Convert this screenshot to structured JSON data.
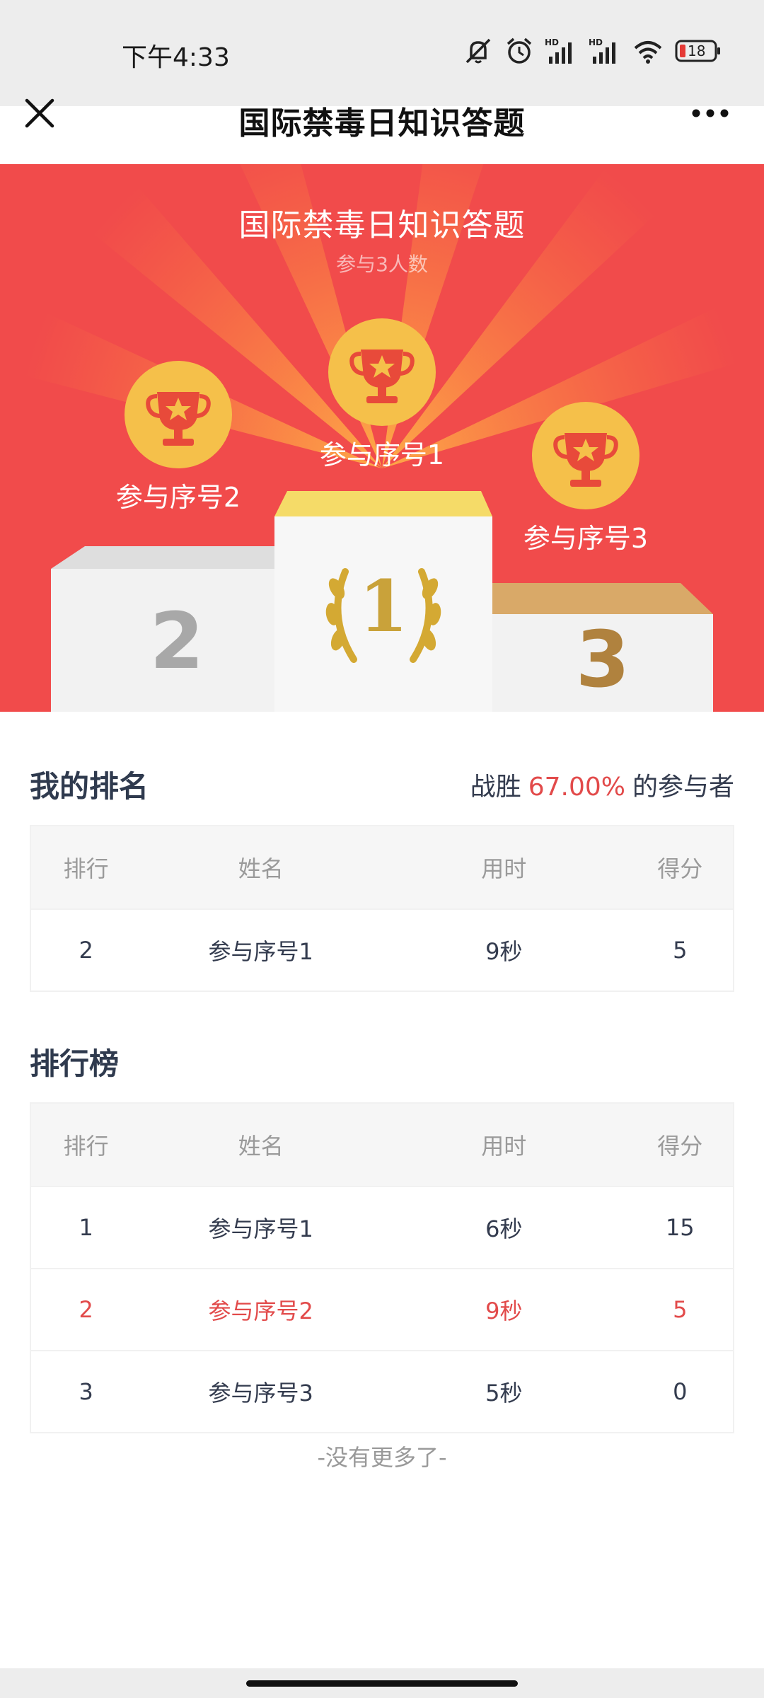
{
  "status_bar": {
    "time": "下午4:33",
    "battery": "18",
    "icons": [
      "mute-icon",
      "alarm-icon",
      "hd-signal-icon",
      "hd-signal-icon",
      "wifi-icon",
      "battery-icon"
    ]
  },
  "nav": {
    "title": "国际禁毒日知识答题",
    "close_icon": "close-icon",
    "more_icon": "more-icon"
  },
  "hero": {
    "title": "国际禁毒日知识答题",
    "subtitle": "参与3人数",
    "first": "参与序号1",
    "second": "参与序号2",
    "third": "参与序号3",
    "podium_numbers": [
      "1",
      "2",
      "3"
    ]
  },
  "my_rank": {
    "title": "我的排名",
    "stat_prefix": "战胜",
    "stat_percent": "67.00%",
    "stat_suffix": "的参与者",
    "headers": [
      "排行",
      "姓名",
      "用时",
      "得分"
    ],
    "row": [
      "2",
      "参与序号1",
      "9秒",
      "5"
    ]
  },
  "leaderboard": {
    "title": "排行榜",
    "headers": [
      "排行",
      "姓名",
      "用时",
      "得分"
    ],
    "rows": [
      [
        "1",
        "参与序号1",
        "6秒",
        "15"
      ],
      [
        "2",
        "参与序号2",
        "9秒",
        "5"
      ],
      [
        "3",
        "参与序号3",
        "5秒",
        "0"
      ]
    ],
    "footer": "-没有更多了-"
  },
  "colors": {
    "hero_red": "#f14b4b",
    "accent_red": "#e24a4a",
    "gold": "#f5c04a",
    "text_dark": "#2f3a4e"
  }
}
